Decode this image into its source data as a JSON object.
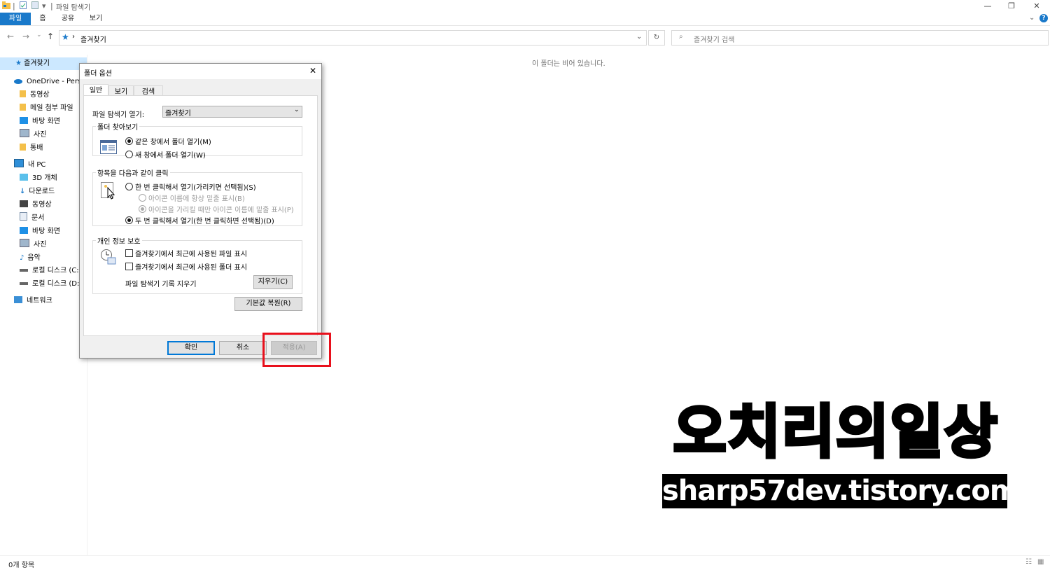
{
  "window": {
    "title": "파일 탐색기",
    "qa_separator": "|",
    "controls": {
      "minimize": "—",
      "maximize": "❐",
      "close": "✕"
    }
  },
  "ribbon": {
    "tabs": [
      "파일",
      "홈",
      "공유",
      "보기"
    ],
    "active_tab": "파일",
    "help": "?"
  },
  "address": {
    "path": "즐겨찾기",
    "separator": "›"
  },
  "search": {
    "placeholder": "즐겨찾기 검색"
  },
  "navpane": {
    "items": [
      {
        "label": "즐겨찾기",
        "icon": "star-icon"
      },
      {
        "label": "OneDrive - Person",
        "icon": "cloud-icon"
      },
      {
        "label": "동영상",
        "icon": "folder-icon"
      },
      {
        "label": "메일 첨부 파일",
        "icon": "folder-icon"
      },
      {
        "label": "바탕 화면",
        "icon": "desktop-icon"
      },
      {
        "label": "사진",
        "icon": "pictures-icon"
      },
      {
        "label": "통배",
        "icon": "folder-icon"
      },
      {
        "label": "내 PC",
        "icon": "pc-icon"
      },
      {
        "label": "3D 개체",
        "icon": "cube-icon"
      },
      {
        "label": "다운로드",
        "icon": "download-icon"
      },
      {
        "label": "동영상",
        "icon": "video-icon"
      },
      {
        "label": "문서",
        "icon": "document-icon"
      },
      {
        "label": "바탕 화면",
        "icon": "desktop-icon"
      },
      {
        "label": "사진",
        "icon": "pictures-icon"
      },
      {
        "label": "음악",
        "icon": "music-icon"
      },
      {
        "label": "로컬 디스크 (C:)",
        "icon": "drive-icon"
      },
      {
        "label": "로컬 디스크 (D:)",
        "icon": "drive-icon"
      },
      {
        "label": "네트워크",
        "icon": "network-icon"
      }
    ]
  },
  "content": {
    "empty_message": "이 폴더는 비어 있습니다."
  },
  "status": {
    "items": "0개 항목"
  },
  "dialog": {
    "title": "폴더 옵션",
    "tabs": [
      "일반",
      "보기",
      "검색"
    ],
    "active_tab": "일반",
    "open_explorer_label": "파일 탐색기 열기:",
    "open_explorer_value": "즐겨찾기",
    "browse_group": {
      "legend": "폴더 찾아보기",
      "options": [
        "같은 창에서 폴더 열기(M)",
        "새 창에서 폴더 열기(W)"
      ],
      "selected": 0
    },
    "click_group": {
      "legend": "항목을 다음과 같이 클릭",
      "single": "한 번 클릭해서 열기(가리키면 선택됨)(S)",
      "sub_always": "아이콘 이름에 항상 밑줄 표시(B)",
      "sub_hover": "아이콘을 가리킬 때만 아이콘 이름에 밑줄 표시(P)",
      "double": "두 번 클릭해서 열기(한 번 클릭하면 선택됨)(D)",
      "selected": "double"
    },
    "privacy_group": {
      "legend": "개인 정보 보호",
      "recent_files": "즐겨찾기에서 최근에 사용된 파일 표시",
      "recent_folders": "즐겨찾기에서 최근에 사용된 폴더 표시",
      "clear_label": "파일 탐색기 기록 지우기",
      "clear_button": "지우기(C)"
    },
    "restore_button": "기본값 복원(R)",
    "ok": "확인",
    "cancel": "취소",
    "apply": "적용(A)",
    "close": "✕"
  },
  "watermark": {
    "line1": "오치리의일상",
    "line2": "sharp57dev.tistory.com"
  },
  "colors": {
    "accent": "#1979ca",
    "highlight": "#e8101c",
    "selection": "#cce8ff"
  }
}
